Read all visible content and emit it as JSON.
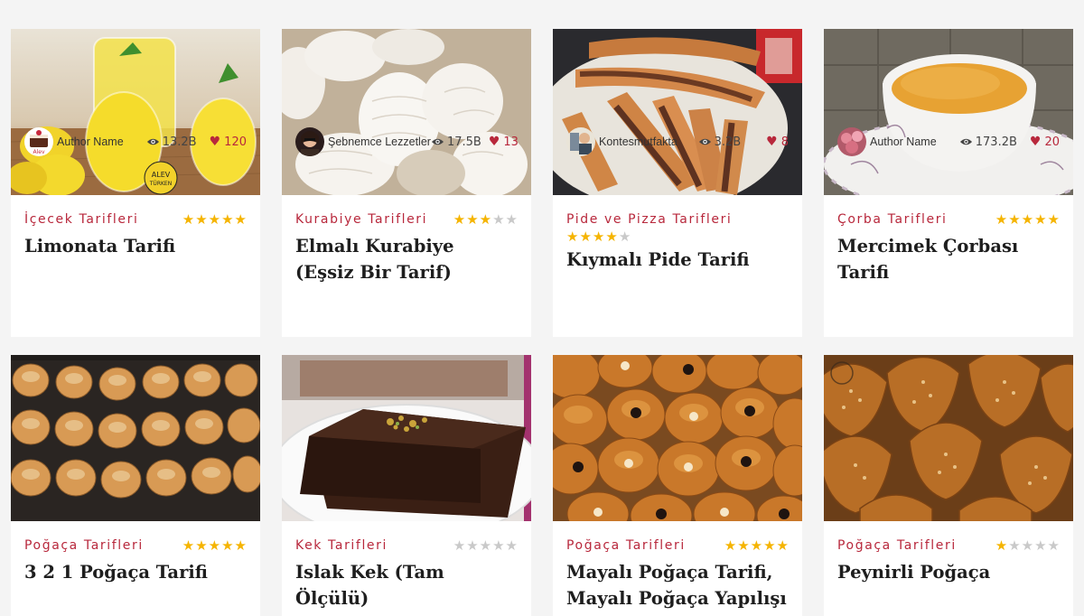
{
  "theme": {
    "accent": "#b8283c",
    "star_on": "#f5b400",
    "star_off": "#c9c9c9",
    "background": "#f4f4f4"
  },
  "cards": [
    {
      "image_alt": "Lemonade in glasses with lemons and mint",
      "category": "İçecek Tarifleri",
      "rating": 5,
      "title": "Limonata Tarifi",
      "author": "Author Name",
      "views": "13.2B",
      "likes": "120"
    },
    {
      "image_alt": "Powdered sugar crescent cookies",
      "category": "Kurabiye Tarifleri",
      "rating": 3,
      "title": "Elmalı Kurabiye (Eşsiz Bir Tarif)",
      "author": "Şebnemce Lezzetler",
      "views": "17.5B",
      "likes": "13"
    },
    {
      "image_alt": "Minced meat pide on tray",
      "category": "Pide ve Pizza Tarifleri",
      "rating": 4,
      "title": "Kıymalı Pide Tarifi",
      "author": "Kontesmutfakta",
      "views": "3.2B",
      "likes": "8"
    },
    {
      "image_alt": "Lentil soup in a bowl",
      "category": "Çorba Tarifleri",
      "rating": 5,
      "title": "Mercimek Çorbası Tarifi",
      "author": "Author Name",
      "views": "173.2B",
      "likes": "20"
    },
    {
      "image_alt": "Round pogaca buns on baking tray",
      "category": "Poğaça Tarifleri",
      "rating": 5,
      "title": "3 2 1 Poğaça Tarifi",
      "author": "",
      "views": "",
      "likes": ""
    },
    {
      "image_alt": "Chocolate wet cake slice with pistachio",
      "category": "Kek Tarifleri",
      "rating": 0,
      "title": "Islak Kek (Tam Ölçülü)",
      "author": "",
      "views": "",
      "likes": ""
    },
    {
      "image_alt": "Yeast pogaca with sesame and nigella seeds",
      "category": "Poğaça Tarifleri",
      "rating": 5,
      "title": "Mayalı Poğaça Tarifi, Mayalı Poğaça Yapılışı",
      "author": "",
      "views": "",
      "likes": ""
    },
    {
      "image_alt": "Cheese pogaca with sesame seeds",
      "category": "Poğaça Tarifleri",
      "rating": 1,
      "title": "Peynirli Poğaça",
      "author": "",
      "views": "",
      "likes": ""
    }
  ]
}
